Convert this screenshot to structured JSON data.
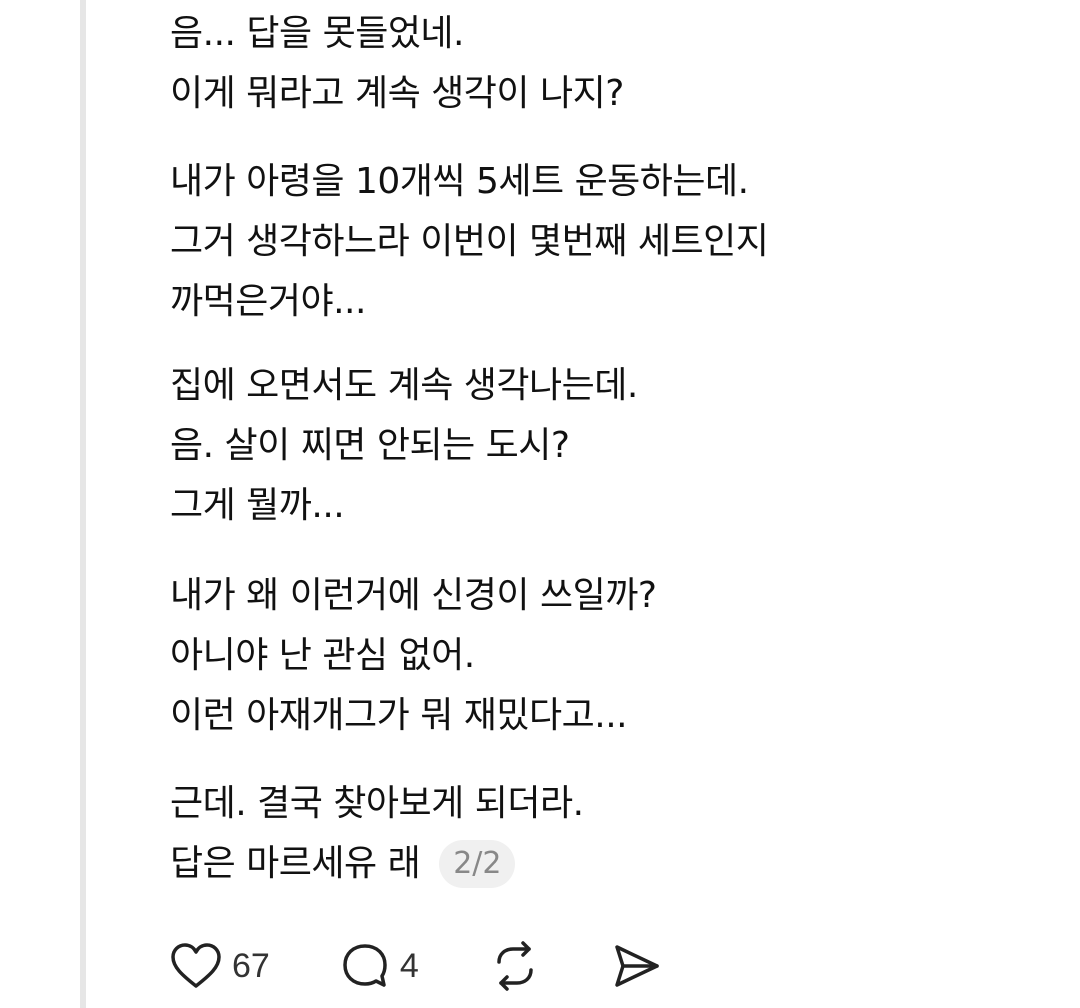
{
  "post": {
    "paragraphs": [
      {
        "lines": [
          "음... 답을 못들었네.",
          "이게 뭐라고 계속 생각이 나지?"
        ]
      },
      {
        "lines": [
          "내가 아령을 10개씩 5세트 운동하는데.",
          "그거 생각하느라 이번이 몇번째 세트인지",
          "까먹은거야..."
        ]
      },
      {
        "lines": [
          "집에 오면서도 계속 생각나는데.",
          "음. 살이 찌면 안되는 도시?",
          "그게 뭘까..."
        ]
      },
      {
        "lines": [
          "내가 왜 이런거에 신경이 쓰일까?",
          "아니야 난 관심 없어.",
          "이런 아재개그가 뭐 재밌다고..."
        ]
      },
      {
        "lines": [
          "근데. 결국 찾아보게 되더라.",
          "답은 마르세유 래"
        ]
      }
    ],
    "page_indicator": "2/2"
  },
  "actions": {
    "like_count": "67",
    "comment_count": "4",
    "like_icon": "heart-icon",
    "comment_icon": "comment-bubble-icon",
    "repost_icon": "repost-icon",
    "share_icon": "send-icon"
  },
  "colors": {
    "text": "#111111",
    "muted": "#888888",
    "badge_bg": "#f0f0f0",
    "thread_line": "#e6e6e6"
  }
}
